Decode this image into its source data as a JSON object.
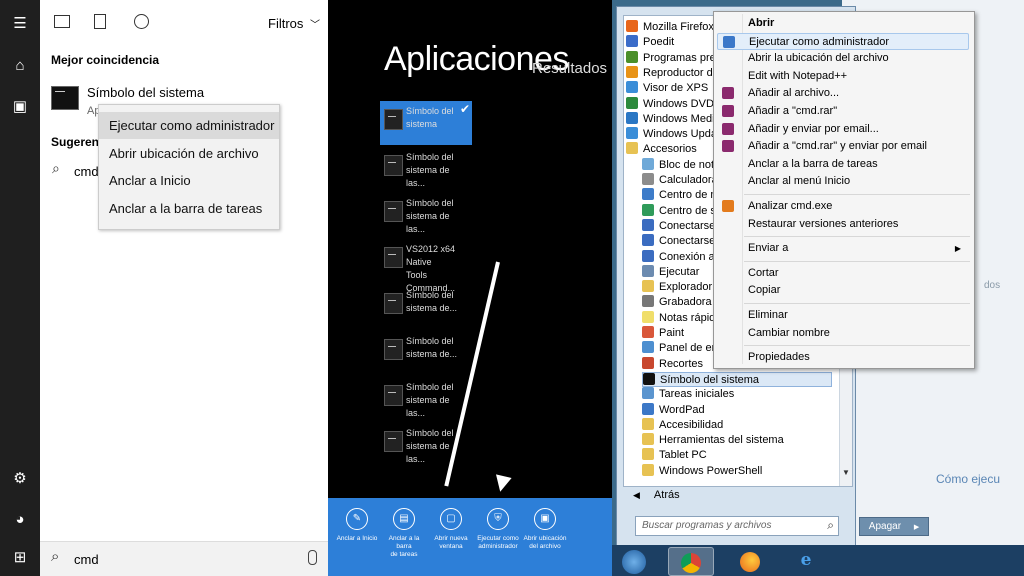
{
  "win10": {
    "topbar": {
      "filters_label": "Filtros"
    },
    "best_match_header": "Mejor coincidencia",
    "result_title": "Símbolo del sistema",
    "result_sub": "Ap",
    "suggestions_header": "Sugeren",
    "suggestion_text": "cmd",
    "context_menu": [
      "Ejecutar como administrador",
      "Abrir ubicación de archivo",
      "Anclar a Inicio",
      "Anclar a la barra de tareas"
    ],
    "search_value": "cmd"
  },
  "win8": {
    "title": "Aplicaciones",
    "subtitle": "Resultados para",
    "apps": [
      {
        "line1": "Símbolo del",
        "line2": "sistema"
      },
      {
        "line1": "Símbolo del",
        "line2": "sistema de las..."
      },
      {
        "line1": "Símbolo del",
        "line2": "sistema de las..."
      },
      {
        "line1": "VS2012 x64 Native",
        "line2": "Tools Command..."
      },
      {
        "line1": "Símbolo del",
        "line2": "sistema de..."
      },
      {
        "line1": "Símbolo del",
        "line2": "sistema de..."
      },
      {
        "line1": "Símbolo del",
        "line2": "sistema de las..."
      },
      {
        "line1": "Símbolo del",
        "line2": "sistema de las..."
      }
    ],
    "appbar": [
      {
        "l1": "Anclar a Inicio",
        "l2": ""
      },
      {
        "l1": "Anclar a la barra",
        "l2": "de tareas"
      },
      {
        "l1": "Abrir nueva",
        "l2": "ventana"
      },
      {
        "l1": "Ejecutar como",
        "l2": "administrador"
      },
      {
        "l1": "Abrir ubicación",
        "l2": "del archivo"
      }
    ]
  },
  "win7": {
    "programs": [
      {
        "label": "Mozilla Firefox",
        "indent": 0,
        "color": "#e8661b"
      },
      {
        "label": "Poedit",
        "indent": 0,
        "color": "#3a6cc9"
      },
      {
        "label": "Programas pred",
        "indent": 0,
        "color": "#4b8f2a"
      },
      {
        "label": "Reproductor de",
        "indent": 0,
        "color": "#e89317"
      },
      {
        "label": "Visor de XPS",
        "indent": 0,
        "color": "#3b8ed8"
      },
      {
        "label": "Windows DVD M",
        "indent": 0,
        "color": "#2c8a3c"
      },
      {
        "label": "Windows Medi",
        "indent": 0,
        "color": "#2a77c4"
      },
      {
        "label": "Windows Upda",
        "indent": 0,
        "color": "#3b8ed8"
      },
      {
        "label": "Accesorios",
        "indent": 0,
        "color": "#e7c253"
      },
      {
        "label": "Bloc de not",
        "indent": 1,
        "color": "#6fa9d8"
      },
      {
        "label": "Calculadora",
        "indent": 1,
        "color": "#8c8c8c"
      },
      {
        "label": "Centro de n",
        "indent": 1,
        "color": "#3d7cc9"
      },
      {
        "label": "Centro de s",
        "indent": 1,
        "color": "#2f9b5a"
      },
      {
        "label": "Conectarse",
        "indent": 1,
        "color": "#3b6cc0"
      },
      {
        "label": "Conectarse",
        "indent": 1,
        "color": "#3b6cc0"
      },
      {
        "label": "Conexión a",
        "indent": 1,
        "color": "#3b6cc0"
      },
      {
        "label": "Ejecutar",
        "indent": 1,
        "color": "#6c8bb0"
      },
      {
        "label": "Explorador d",
        "indent": 1,
        "color": "#e7c253"
      },
      {
        "label": "Grabadora d",
        "indent": 1,
        "color": "#777777"
      },
      {
        "label": "Notas rápid",
        "indent": 1,
        "color": "#f0de6a"
      },
      {
        "label": "Paint",
        "indent": 1,
        "color": "#d9573a"
      },
      {
        "label": "Panel de en",
        "indent": 1,
        "color": "#4d8fd0"
      },
      {
        "label": "Recortes",
        "indent": 1,
        "color": "#c8472e"
      },
      {
        "label": "Símbolo del sistema",
        "indent": 1,
        "color": "#111111"
      },
      {
        "label": "Tareas iniciales",
        "indent": 1,
        "color": "#5b95cf"
      },
      {
        "label": "WordPad",
        "indent": 1,
        "color": "#3c78c7"
      },
      {
        "label": "Accesibilidad",
        "indent": 1,
        "color": "#e7c253"
      },
      {
        "label": "Herramientas del sistema",
        "indent": 1,
        "color": "#e7c253"
      },
      {
        "label": "Tablet PC",
        "indent": 1,
        "color": "#e7c253"
      },
      {
        "label": "Windows PowerShell",
        "indent": 1,
        "color": "#e7c253"
      }
    ],
    "back_label": "Atrás",
    "search_placeholder": "Buscar programas y archivos",
    "shutdown_label": "Apagar",
    "context_menu": [
      {
        "label": "Abrir",
        "bold": true,
        "icon": ""
      },
      {
        "label": "Ejecutar como administrador",
        "icon": "#3b78c9",
        "hl": true
      },
      {
        "label": "Abrir la ubicación del archivo",
        "icon": ""
      },
      {
        "label": "Edit with Notepad++",
        "icon": ""
      },
      {
        "label": "Añadir al archivo...",
        "icon": "#8b2a6e"
      },
      {
        "label": "Añadir a \"cmd.rar\"",
        "icon": "#8b2a6e"
      },
      {
        "label": "Añadir y enviar por email...",
        "icon": "#8b2a6e"
      },
      {
        "label": "Añadir a \"cmd.rar\" y enviar por email",
        "icon": "#8b2a6e"
      },
      {
        "label": "Anclar a la barra de tareas",
        "icon": ""
      },
      {
        "label": "Anclar al menú Inicio",
        "icon": ""
      },
      {
        "sep": true
      },
      {
        "label": "Analizar cmd.exe",
        "icon": "#e37b1d"
      },
      {
        "label": "Restaurar versiones anteriores",
        "icon": ""
      },
      {
        "sep": true
      },
      {
        "label": "Enviar a",
        "icon": "",
        "submenu": true
      },
      {
        "sep": true
      },
      {
        "label": "Cortar",
        "icon": ""
      },
      {
        "label": "Copiar",
        "icon": ""
      },
      {
        "sep": true
      },
      {
        "label": "Eliminar",
        "icon": ""
      },
      {
        "label": "Cambiar nombre",
        "icon": ""
      },
      {
        "sep": true
      },
      {
        "label": "Propiedades",
        "icon": ""
      }
    ],
    "bg_fragments": [
      "dos",
      "Cómo ejecu"
    ]
  }
}
